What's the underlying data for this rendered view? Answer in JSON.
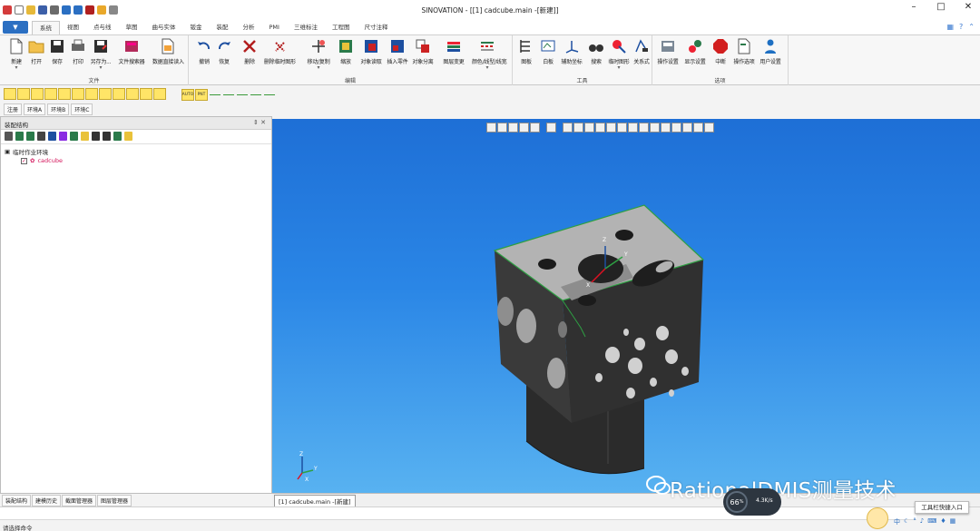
{
  "window": {
    "title": "SINOVATION - [[1] cadcube.main -[新建]]"
  },
  "menu": {
    "app_button": "▼",
    "tabs": [
      "系统",
      "视图",
      "点与线",
      "草图",
      "曲与实体",
      "钣金",
      "装配",
      "分析",
      "PMI",
      "三维标注",
      "工程图",
      "尺寸注释"
    ],
    "active_tab": "系统"
  },
  "ribbon": {
    "groups": [
      {
        "label": "文件",
        "buttons": [
          "新建",
          "打开",
          "保存",
          "打印",
          "另存为...",
          "文件搜索器",
          "数据直接读入"
        ]
      },
      {
        "label": "编辑",
        "buttons": [
          "撤销",
          "恢复",
          "删除",
          "删除临时图形",
          "移动/复制",
          "缩放",
          "对象读取",
          "插入零件",
          "对象分离",
          "图层变更",
          "颜色/线型/线宽"
        ]
      },
      {
        "label": "工具",
        "buttons": [
          "图板",
          "白板",
          "辅助坐标",
          "搜索",
          "临时图形",
          "关系式"
        ]
      },
      {
        "label": "选项",
        "buttons": [
          "操作设置",
          "显示设置",
          "中断",
          "操作选项",
          "用户设置"
        ]
      }
    ]
  },
  "env_tabs": [
    "注册",
    "环境A",
    "环境B",
    "环境C"
  ],
  "snap_labels": {
    "auto": "AUTO",
    "point": "PNT"
  },
  "left_panel": {
    "title": "装配结构",
    "tree_root": "临时作业环境",
    "tree_child": "cadcube",
    "bottom_tabs": [
      "装配结构",
      "建模历史",
      "截面管理器",
      "图层管理器"
    ]
  },
  "doc_tab": "[1] cadcube.main -[新建]",
  "status": {
    "prompt": "请选择命令"
  },
  "overlay": {
    "watermark": "RationalDMIS测量技术",
    "perf_percent": "66",
    "perf_unit": "%",
    "perf_speed": "4.3K/s",
    "tooltip": "工具栏快捷入口"
  },
  "axis_labels": {
    "x": "X",
    "y": "Y",
    "z": "Z"
  },
  "colors": {
    "viewport_top": "#1e6fd6",
    "viewport_bottom": "#58b2f1",
    "accent": "#2b6fc2",
    "model_edge": "#2ea043",
    "tree_child": "#d4145a"
  }
}
